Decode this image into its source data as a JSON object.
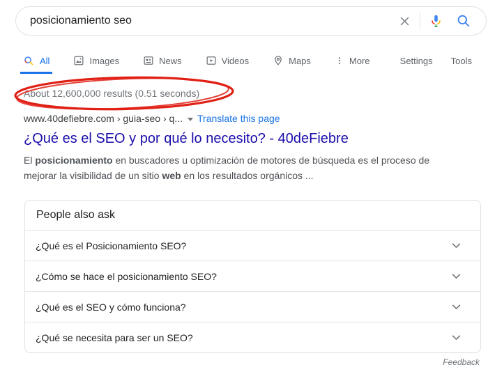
{
  "search_bar": {
    "query": "posicionamiento seo"
  },
  "tabs": {
    "items": [
      {
        "label": "All",
        "icon": "search-colored",
        "active": true
      },
      {
        "label": "Images",
        "icon": "images"
      },
      {
        "label": "News",
        "icon": "news"
      },
      {
        "label": "Videos",
        "icon": "videos"
      },
      {
        "label": "Maps",
        "icon": "maps"
      },
      {
        "label": "More",
        "icon": "more-vertical-dots"
      }
    ],
    "settings": "Settings",
    "tools": "Tools"
  },
  "stats": {
    "text": "About 12,600,000 results (0.51 seconds)"
  },
  "result": {
    "breadcrumb": "www.40defiebre.com › guia-seo › q...",
    "translate_link": "Translate this page",
    "title": "¿Qué es el SEO y por qué lo necesito? - 40deFiebre",
    "snippet": {
      "l1a": "El ",
      "l1b": "posicionamiento",
      "l1c": " en buscadores u optimización de motores de búsqueda es el proceso de",
      "l2a": "mejorar la visibilidad de un sitio ",
      "l2b": "web",
      "l2c": " en los resultados orgánicos ..."
    }
  },
  "people_also_ask": {
    "title": "People also ask",
    "questions": [
      "¿Qué es el Posicionamiento SEO?",
      "¿Cómo se hace el posicionamiento SEO?",
      "¿Qué es el SEO y cómo funciona?",
      "¿Qué se necesita para ser un SEO?"
    ],
    "feedback": "Feedback"
  },
  "colors": {
    "result_link_blue": "#1a0dab",
    "active_tab_blue": "#1a73e8",
    "muted_text_gray": "#70757a",
    "border_gray": "#dfe1e5",
    "annotation_red": "#e02015",
    "google_blue": "#4285f4",
    "google_red": "#ea4335",
    "google_yellow": "#fbbc05",
    "google_green": "#34a853"
  }
}
